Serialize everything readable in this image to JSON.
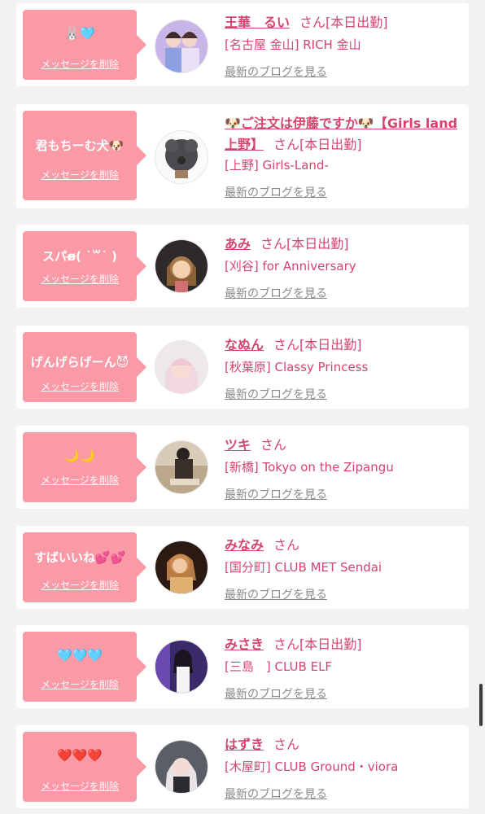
{
  "messages": [
    {
      "nickname": "🐰🩵",
      "delete_label": "メッセージを削除",
      "name": "王華　るい",
      "san": "さん",
      "attendance": "[本日出勤]",
      "shop": "[名古屋 金山] RICH 金山",
      "blog": "最新のブログを見る"
    },
    {
      "nickname": "君もちーむ犬🐶",
      "delete_label": "メッセージを削除",
      "name_line1": "🐶ご注文は伊藤ですか🐶【Girls land",
      "name_line2": "上野】",
      "san": "さん",
      "attendance": "[本日出勤]",
      "shop": "[上野] Girls-Land-",
      "blog": "最新のブログを見る"
    },
    {
      "nickname": "スパɞ̴̶̷( ˙꒳˙ )",
      "delete_label": "メッセージを削除",
      "name": "あみ",
      "san": "さん",
      "attendance": "[本日出勤]",
      "shop": "[刈谷] for Anniversary",
      "blog": "最新のブログを見る"
    },
    {
      "nickname": "げんげらげーん😈",
      "delete_label": "メッセージを削除",
      "name": "なぬん",
      "san": "さん",
      "attendance": "[本日出勤]",
      "shop": "[秋葉原] Classy Princess",
      "blog": "最新のブログを見る"
    },
    {
      "nickname": "🌙🌙",
      "delete_label": "メッセージを削除",
      "name": "ツキ",
      "san": "さん",
      "attendance": "",
      "shop": "[新橋] Tokyo on the Zipangu",
      "blog": "最新のブログを見る"
    },
    {
      "nickname": "すばいいね💕💕",
      "delete_label": "メッセージを削除",
      "name": "みなみ",
      "san": "さん",
      "attendance": "",
      "shop": "[国分町] CLUB MET Sendai",
      "blog": "最新のブログを見る"
    },
    {
      "nickname": "🩵🩵🩵",
      "delete_label": "メッセージを削除",
      "name": "みさき",
      "san": "さん",
      "attendance": "[本日出勤]",
      "shop": "[三島　] CLUB ELF",
      "blog": "最新のブログを見る"
    },
    {
      "nickname": "❤️❤️❤️",
      "delete_label": "メッセージを削除",
      "name": "はずき",
      "san": "さん",
      "attendance": "",
      "shop": "[木屋町] CLUB Ground・viora",
      "blog": "最新のブログを見る"
    }
  ],
  "colors": {
    "accent": "#d4456e",
    "bubble": "#f99aa6",
    "background": "#f2f2f2"
  }
}
